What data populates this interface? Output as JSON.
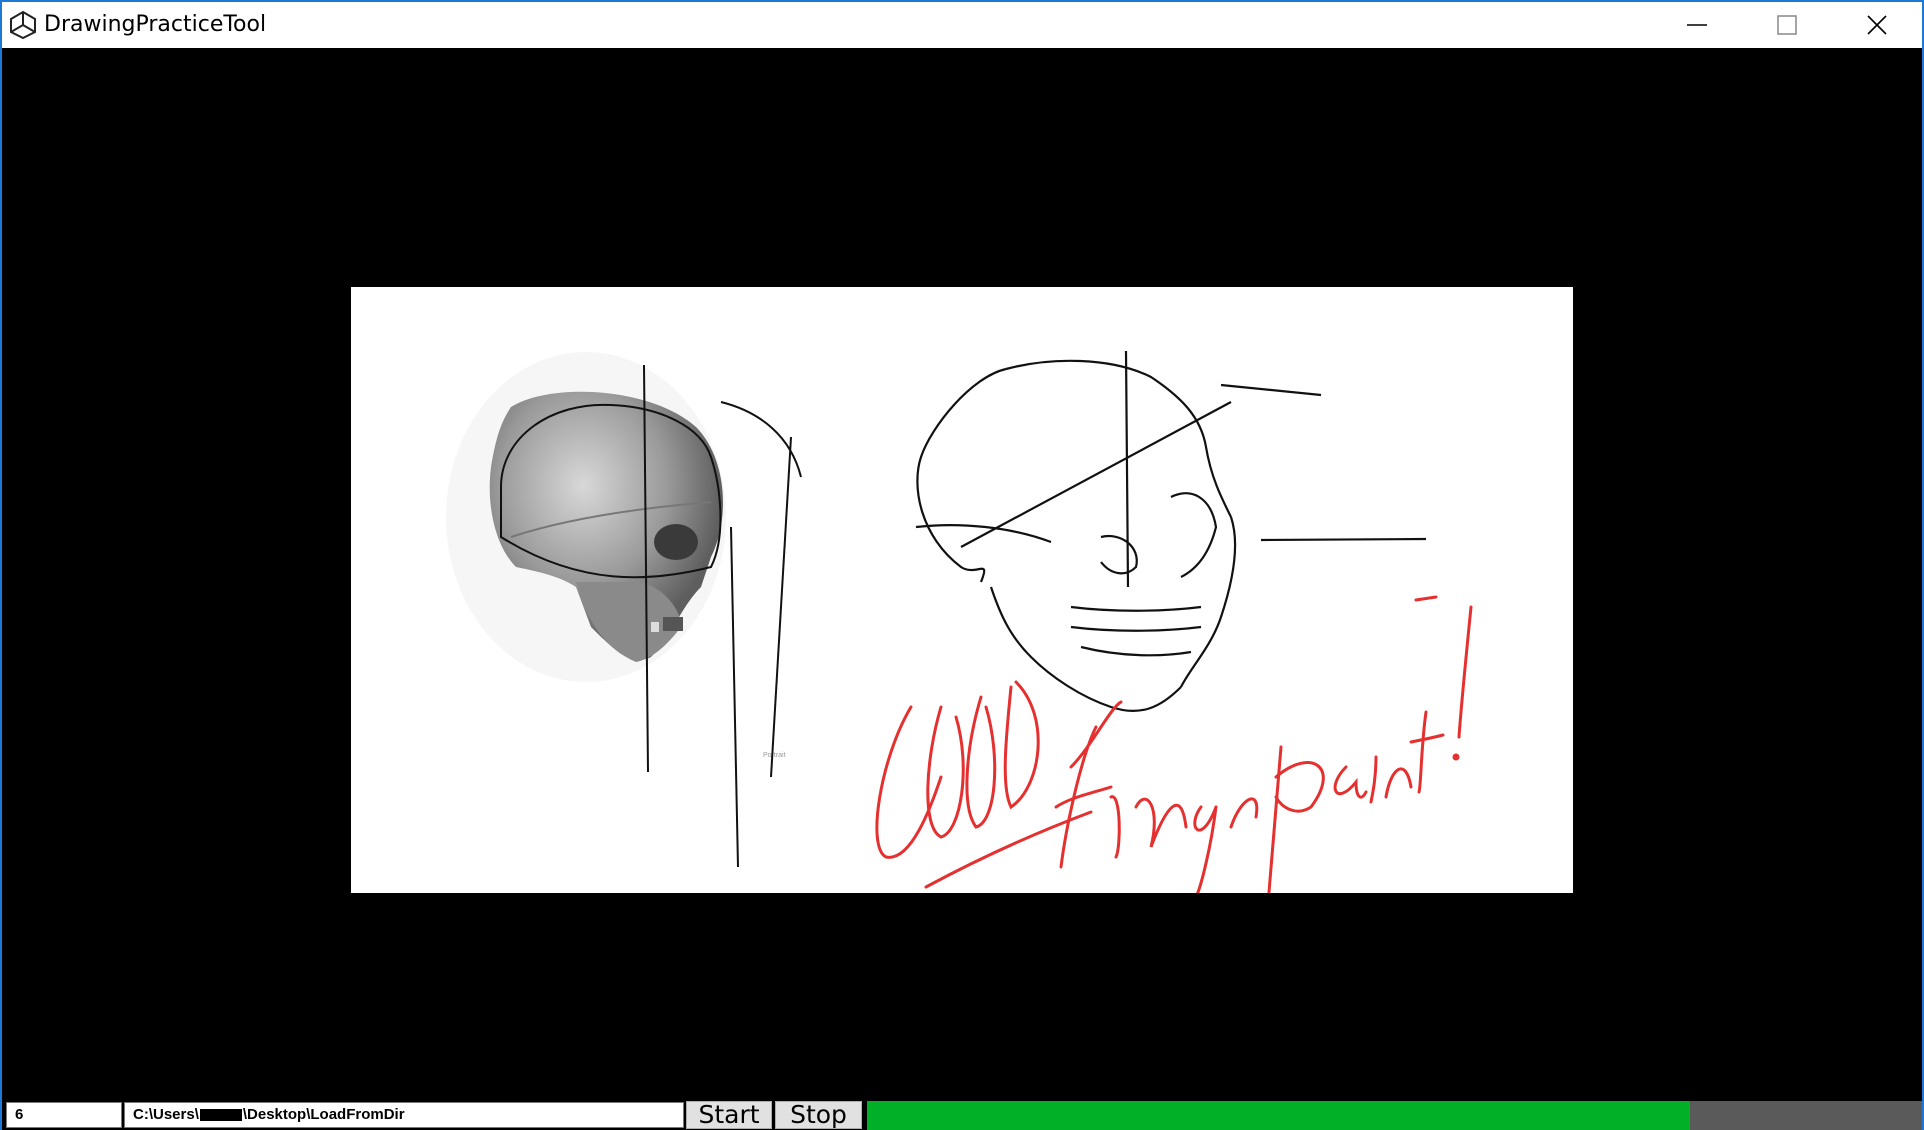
{
  "window": {
    "title": "DrawingPracticeTool",
    "border_color": "#1e78d6",
    "controls": [
      "minimize-icon",
      "maximize-icon",
      "close-icon"
    ]
  },
  "canvas": {
    "background": "#000000",
    "image": {
      "description_icons": [
        "skull-reference-photo",
        "skull-sketch"
      ],
      "annotation_text": [
        "GOOD",
        "finger",
        "paint!"
      ],
      "annotation_color": "#e53030",
      "watermark": "Portrait ©"
    }
  },
  "bottombar": {
    "interval_value": "6",
    "path_prefix": "C:\\Users\\",
    "path_suffix": "\\Desktop\\LoadFromDir",
    "start_label": "Start",
    "stop_label": "Stop",
    "progress_fraction": 0.78,
    "progress_color": "#00b026",
    "progress_track_color": "#5a5a5a"
  }
}
